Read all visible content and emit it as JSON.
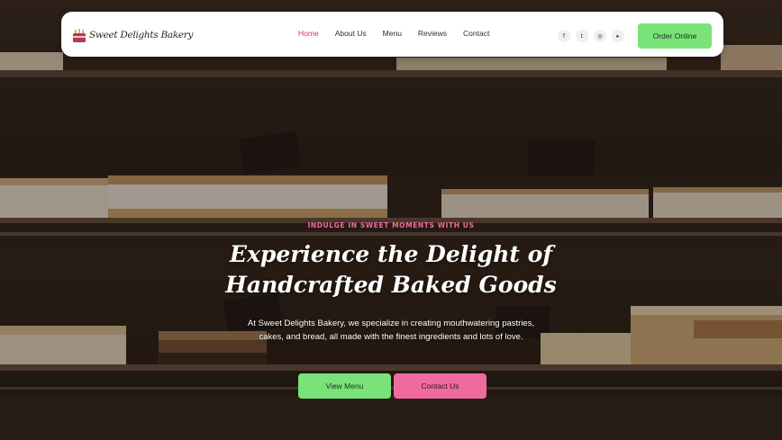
{
  "brand": {
    "name": "Sweet Delights Bakery",
    "logo_icon": "cake-icon"
  },
  "nav": {
    "links": [
      {
        "label": "Home",
        "active": true
      },
      {
        "label": "About Us",
        "active": false
      },
      {
        "label": "Menu",
        "active": false
      },
      {
        "label": "Reviews",
        "active": false
      },
      {
        "label": "Contact",
        "active": false
      }
    ],
    "socials": [
      {
        "icon": "facebook-icon",
        "glyph": "f"
      },
      {
        "icon": "twitter-icon",
        "glyph": "t"
      },
      {
        "icon": "instagram-icon",
        "glyph": "◎"
      },
      {
        "icon": "youtube-icon",
        "glyph": "▸"
      }
    ],
    "order_label": "Order Online"
  },
  "hero": {
    "eyebrow": "INDULGE IN SWEET MOMENTS WITH US",
    "headline_line1": "Experience the Delight of",
    "headline_line2": "Handcrafted Baked Goods",
    "lede": "At Sweet Delights Bakery, we specialize in creating mouthwatering pastries, cakes, and bread, all made with the finest ingredients and lots of love.",
    "primary_label": "View Menu",
    "secondary_label": "Contact Us"
  },
  "colors": {
    "accent_green": "#79e37a",
    "accent_pink": "#f06b9d",
    "active_link": "#d2366f"
  }
}
